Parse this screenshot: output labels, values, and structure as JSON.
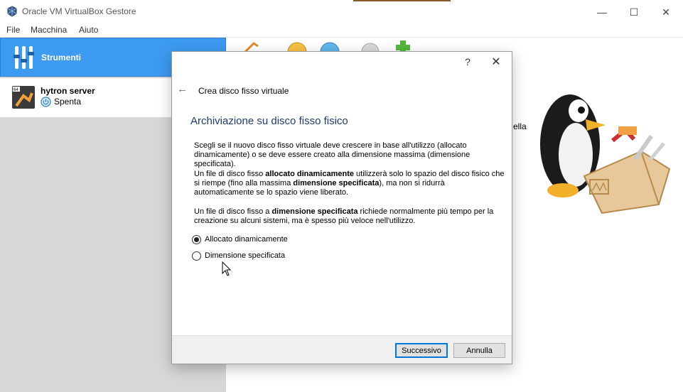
{
  "window": {
    "title": "Oracle VM VirtualBox Gestore",
    "minimize": "—",
    "maximize": "☐",
    "close": "✕"
  },
  "menu": [
    "File",
    "Macchina",
    "Aiuto"
  ],
  "sidebar": {
    "tools_label": "Strumenti",
    "vm": {
      "name": "hytron server",
      "state": "Spenta"
    }
  },
  "background": {
    "partial_text": "ella"
  },
  "dialog": {
    "help": "?",
    "close": "✕",
    "back": "←",
    "title": "Crea disco fisso virtuale",
    "heading": "Archiviazione su disco fisso fisico",
    "p1": "Scegli se il nuovo disco fisso virtuale deve crescere in base all'utilizzo (allocato dinamicamente) o se deve essere creato alla dimensione massima (dimensione specificata).",
    "p2": {
      "a": "Un file di disco fisso ",
      "b": "allocato dinamicamente",
      "c": " utilizzerà solo lo spazio del disco fisico che si riempe (fino alla massima ",
      "d": "dimensione specificata",
      "e": "), ma non si ridurrà automaticamente se lo spazio viene liberato."
    },
    "p3": {
      "a": "Un file di disco fisso a ",
      "b": "dimensione specificata",
      "c": " richiede normalmente più tempo per la creazione su alcuni sistemi, ma è spesso più veloce nell'utilizzo."
    },
    "options": [
      {
        "label": "Allocato dinamicamente",
        "checked": true
      },
      {
        "label": "Dimensione specificata",
        "checked": false
      }
    ],
    "next_label": "Successivo",
    "cancel_label": "Annulla"
  }
}
